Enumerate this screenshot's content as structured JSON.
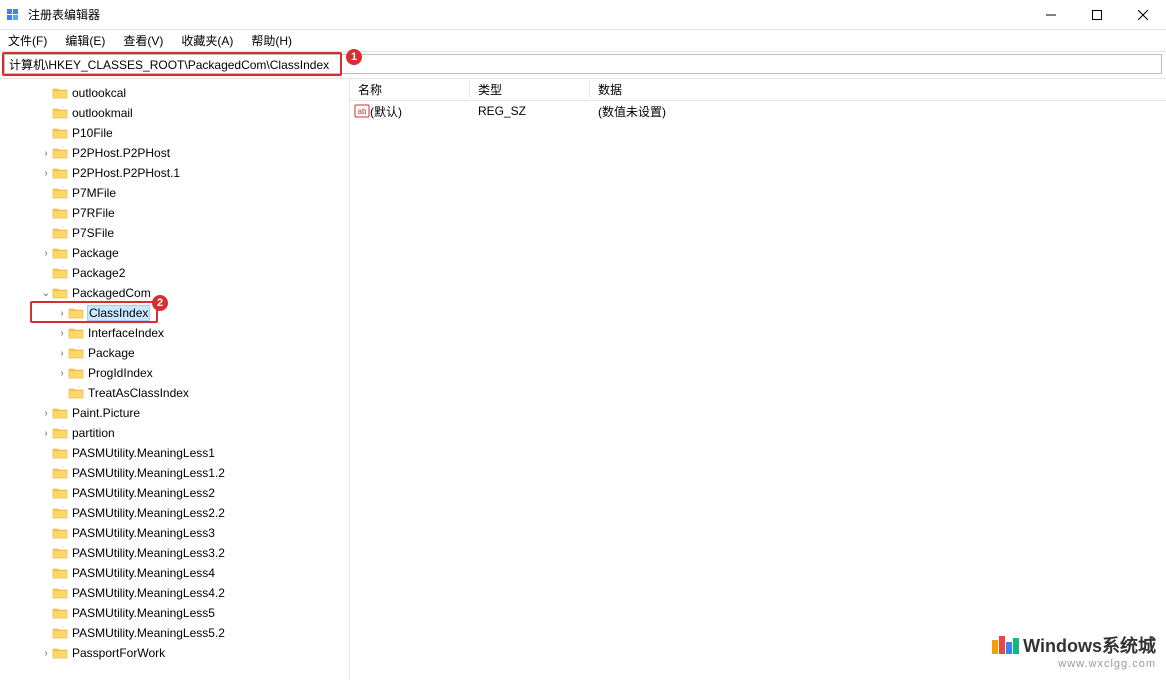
{
  "window": {
    "title": "注册表编辑器"
  },
  "menu": {
    "file": "文件(F)",
    "edit": "编辑(E)",
    "view": "查看(V)",
    "favorites": "收藏夹(A)",
    "help": "帮助(H)"
  },
  "address": {
    "path": "计算机\\HKEY_CLASSES_ROOT\\PackagedCom\\ClassIndex"
  },
  "annotations": {
    "badge1": "1",
    "badge2": "2"
  },
  "tree": {
    "items": [
      {
        "label": "outlookcal",
        "indent": 2,
        "chevron": ""
      },
      {
        "label": "outlookmail",
        "indent": 2,
        "chevron": ""
      },
      {
        "label": "P10File",
        "indent": 2,
        "chevron": ""
      },
      {
        "label": "P2PHost.P2PHost",
        "indent": 2,
        "chevron": ">"
      },
      {
        "label": "P2PHost.P2PHost.1",
        "indent": 2,
        "chevron": ">"
      },
      {
        "label": "P7MFile",
        "indent": 2,
        "chevron": ""
      },
      {
        "label": "P7RFile",
        "indent": 2,
        "chevron": ""
      },
      {
        "label": "P7SFile",
        "indent": 2,
        "chevron": ""
      },
      {
        "label": "Package",
        "indent": 2,
        "chevron": ">"
      },
      {
        "label": "Package2",
        "indent": 2,
        "chevron": ""
      },
      {
        "label": "PackagedCom",
        "indent": 2,
        "chevron": "v"
      },
      {
        "label": "ClassIndex",
        "indent": 3,
        "chevron": ">",
        "selected": true,
        "highlight": true
      },
      {
        "label": "InterfaceIndex",
        "indent": 3,
        "chevron": ">"
      },
      {
        "label": "Package",
        "indent": 3,
        "chevron": ">"
      },
      {
        "label": "ProgIdIndex",
        "indent": 3,
        "chevron": ">"
      },
      {
        "label": "TreatAsClassIndex",
        "indent": 3,
        "chevron": ""
      },
      {
        "label": "Paint.Picture",
        "indent": 2,
        "chevron": ">"
      },
      {
        "label": "partition",
        "indent": 2,
        "chevron": ">"
      },
      {
        "label": "PASMUtility.MeaningLess1",
        "indent": 2,
        "chevron": ""
      },
      {
        "label": "PASMUtility.MeaningLess1.2",
        "indent": 2,
        "chevron": ""
      },
      {
        "label": "PASMUtility.MeaningLess2",
        "indent": 2,
        "chevron": ""
      },
      {
        "label": "PASMUtility.MeaningLess2.2",
        "indent": 2,
        "chevron": ""
      },
      {
        "label": "PASMUtility.MeaningLess3",
        "indent": 2,
        "chevron": ""
      },
      {
        "label": "PASMUtility.MeaningLess3.2",
        "indent": 2,
        "chevron": ""
      },
      {
        "label": "PASMUtility.MeaningLess4",
        "indent": 2,
        "chevron": ""
      },
      {
        "label": "PASMUtility.MeaningLess4.2",
        "indent": 2,
        "chevron": ""
      },
      {
        "label": "PASMUtility.MeaningLess5",
        "indent": 2,
        "chevron": ""
      },
      {
        "label": "PASMUtility.MeaningLess5.2",
        "indent": 2,
        "chevron": ""
      },
      {
        "label": "PassportForWork",
        "indent": 2,
        "chevron": ">"
      }
    ]
  },
  "values": {
    "header": {
      "name": "名称",
      "type": "类型",
      "data": "数据"
    },
    "rows": [
      {
        "name": "(默认)",
        "type": "REG_SZ",
        "data": "(数值未设置)"
      }
    ]
  },
  "watermark": {
    "title": "Windows系统城",
    "sub": "www.wxclgg.com"
  }
}
